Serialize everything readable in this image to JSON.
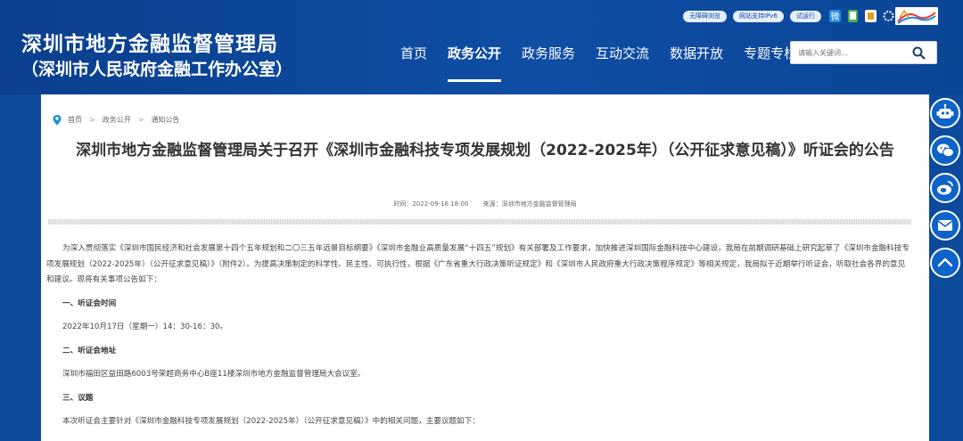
{
  "header": {
    "title": "深圳市地方金融监督管理局",
    "subtitle": "（深圳市人民政府金融工作办公室）",
    "badges": [
      "无障碍浏览",
      "网站支持IPv6",
      "试运行"
    ],
    "nav": [
      "首页",
      "政务公开",
      "政务服务",
      "互动交流",
      "数据开放",
      "专题专栏"
    ],
    "active_nav": "政务公开",
    "search_placeholder": "请输入关键词..."
  },
  "breadcrumb": {
    "items": [
      "首页",
      "政务公开",
      "通知公告"
    ],
    "separator": ">"
  },
  "article": {
    "title": "深圳市地方金融监督管理局关于召开《深圳市金融科技专项发展规划（2022-2025年）（公开征求意见稿）》听证会的公告",
    "time": "时间：2022-09-16 18:00",
    "source": "来源：深圳市地方金融监督管理局",
    "intro": "为深入贯彻落实《深圳市国民经济和社会发展第十四个五年规划和二〇三五年远景目标纲要》《深圳市金融业高质量发展“十四五”规划》有关部署及工作要求，加快推进深圳国际金融科技中心建设，我局在前期调研基础上研究起草了《深圳市金融科技专项发展规划（2022-2025年）（公开征求意见稿）》（附件2）。为提高决策制定的科学性、民主性、可执行性，根据《广东省重大行政决策听证规定》和《深圳市人民政府重大行政决策程序规定》等相关规定，我局拟于近期举行听证会，听取社会各界的意见和建议。现将有关事项公告如下：",
    "s1_title": "一、听证会时间",
    "s1_text": "2022年10月17日（星期一）14：30-16：30。",
    "s2_title": "二、听证会地址",
    "s2_text": "深圳市福田区益田路6003号荣超商务中心B座11楼深圳市地方金融监督管理局大会议室。",
    "s3_title": "三、议题",
    "s3_text": "本次听证会主要针对《深圳市金融科技专项发展规划（2022-2025年）（公开征求意见稿）》中的相关问题，主要议题如下："
  },
  "colors": {
    "header_bg": "#0d4a9c",
    "float_btn": "#0d63c9",
    "accent": "#1f8fd6"
  },
  "icons": [
    "search-icon",
    "location-icon",
    "robot-icon",
    "wechat-icon",
    "weibo-icon",
    "mail-icon",
    "back-to-top-icon"
  ]
}
